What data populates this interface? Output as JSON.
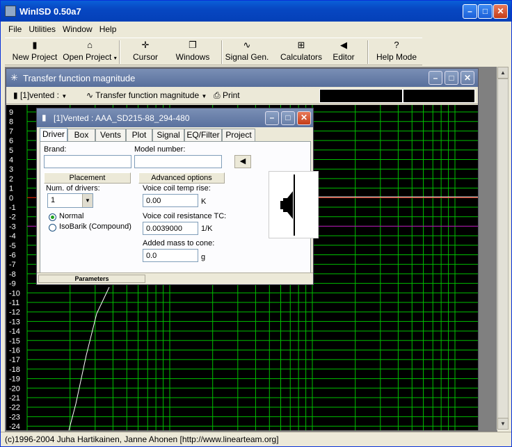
{
  "app": {
    "title": "WinISD 0.50a7"
  },
  "menu": [
    "File",
    "Utilities",
    "Window",
    "Help"
  ],
  "toolbar": {
    "new_project": "New Project",
    "open_project": "Open Project",
    "cursor": "Cursor",
    "windows": "Windows",
    "signal_gen": "Signal Gen.",
    "calculators": "Calculators",
    "editor": "Editor",
    "help_mode": "Help Mode"
  },
  "child_window": {
    "title": "Transfer function magnitude",
    "project_dropdown": "[1]vented :",
    "graph_dropdown": "Transfer function magnitude",
    "print": "Print"
  },
  "graph": {
    "y_ticks": [
      "9",
      "8",
      "7",
      "6",
      "5",
      "4",
      "3",
      "2",
      "1",
      "0",
      "-1",
      "-2",
      "-3",
      "-4",
      "-5",
      "-6",
      "-7",
      "-8",
      "-9",
      "-10",
      "-11",
      "-12",
      "-13",
      "-14",
      "-15",
      "-16",
      "-17",
      "-18",
      "-19",
      "-20",
      "-21",
      "-22",
      "-23",
      "-24"
    ],
    "colors": {
      "background": "#000000",
      "grid": "#00c000",
      "curve": "#ffffff",
      "line_zero": "#ff0000",
      "line_minus3": "#c000c0"
    }
  },
  "dialog": {
    "title": "[1]Vented : AAA_SD215-88_294-480",
    "tabs": [
      "Driver",
      "Box",
      "Vents",
      "Plot",
      "Signal",
      "EQ/Filter",
      "Project"
    ],
    "brand_label": "Brand:",
    "brand_value": "",
    "model_label": "Model number:",
    "model_value": "",
    "placement": "Placement",
    "advanced_options": "Advanced options",
    "num_drivers_label": "Num. of drivers:",
    "num_drivers_value": "1",
    "radio_normal": "Normal",
    "radio_isobarik": "IsoBarik (Compound)",
    "vc_temp_label": "Voice coil temp rise:",
    "vc_temp_value": "0.00",
    "vc_temp_unit": "K",
    "vc_res_label": "Voice coil resistance TC:",
    "vc_res_value": "0.0039000",
    "vc_res_unit": "1/K",
    "added_mass_label": "Added mass to cone:",
    "added_mass_value": "0.0",
    "added_mass_unit": "g",
    "status_tab": "Parameters"
  },
  "statusbar": {
    "text": "(c)1996-2004 Juha Hartikainen, Janne Ahonen [http://www.linearteam.org]"
  }
}
